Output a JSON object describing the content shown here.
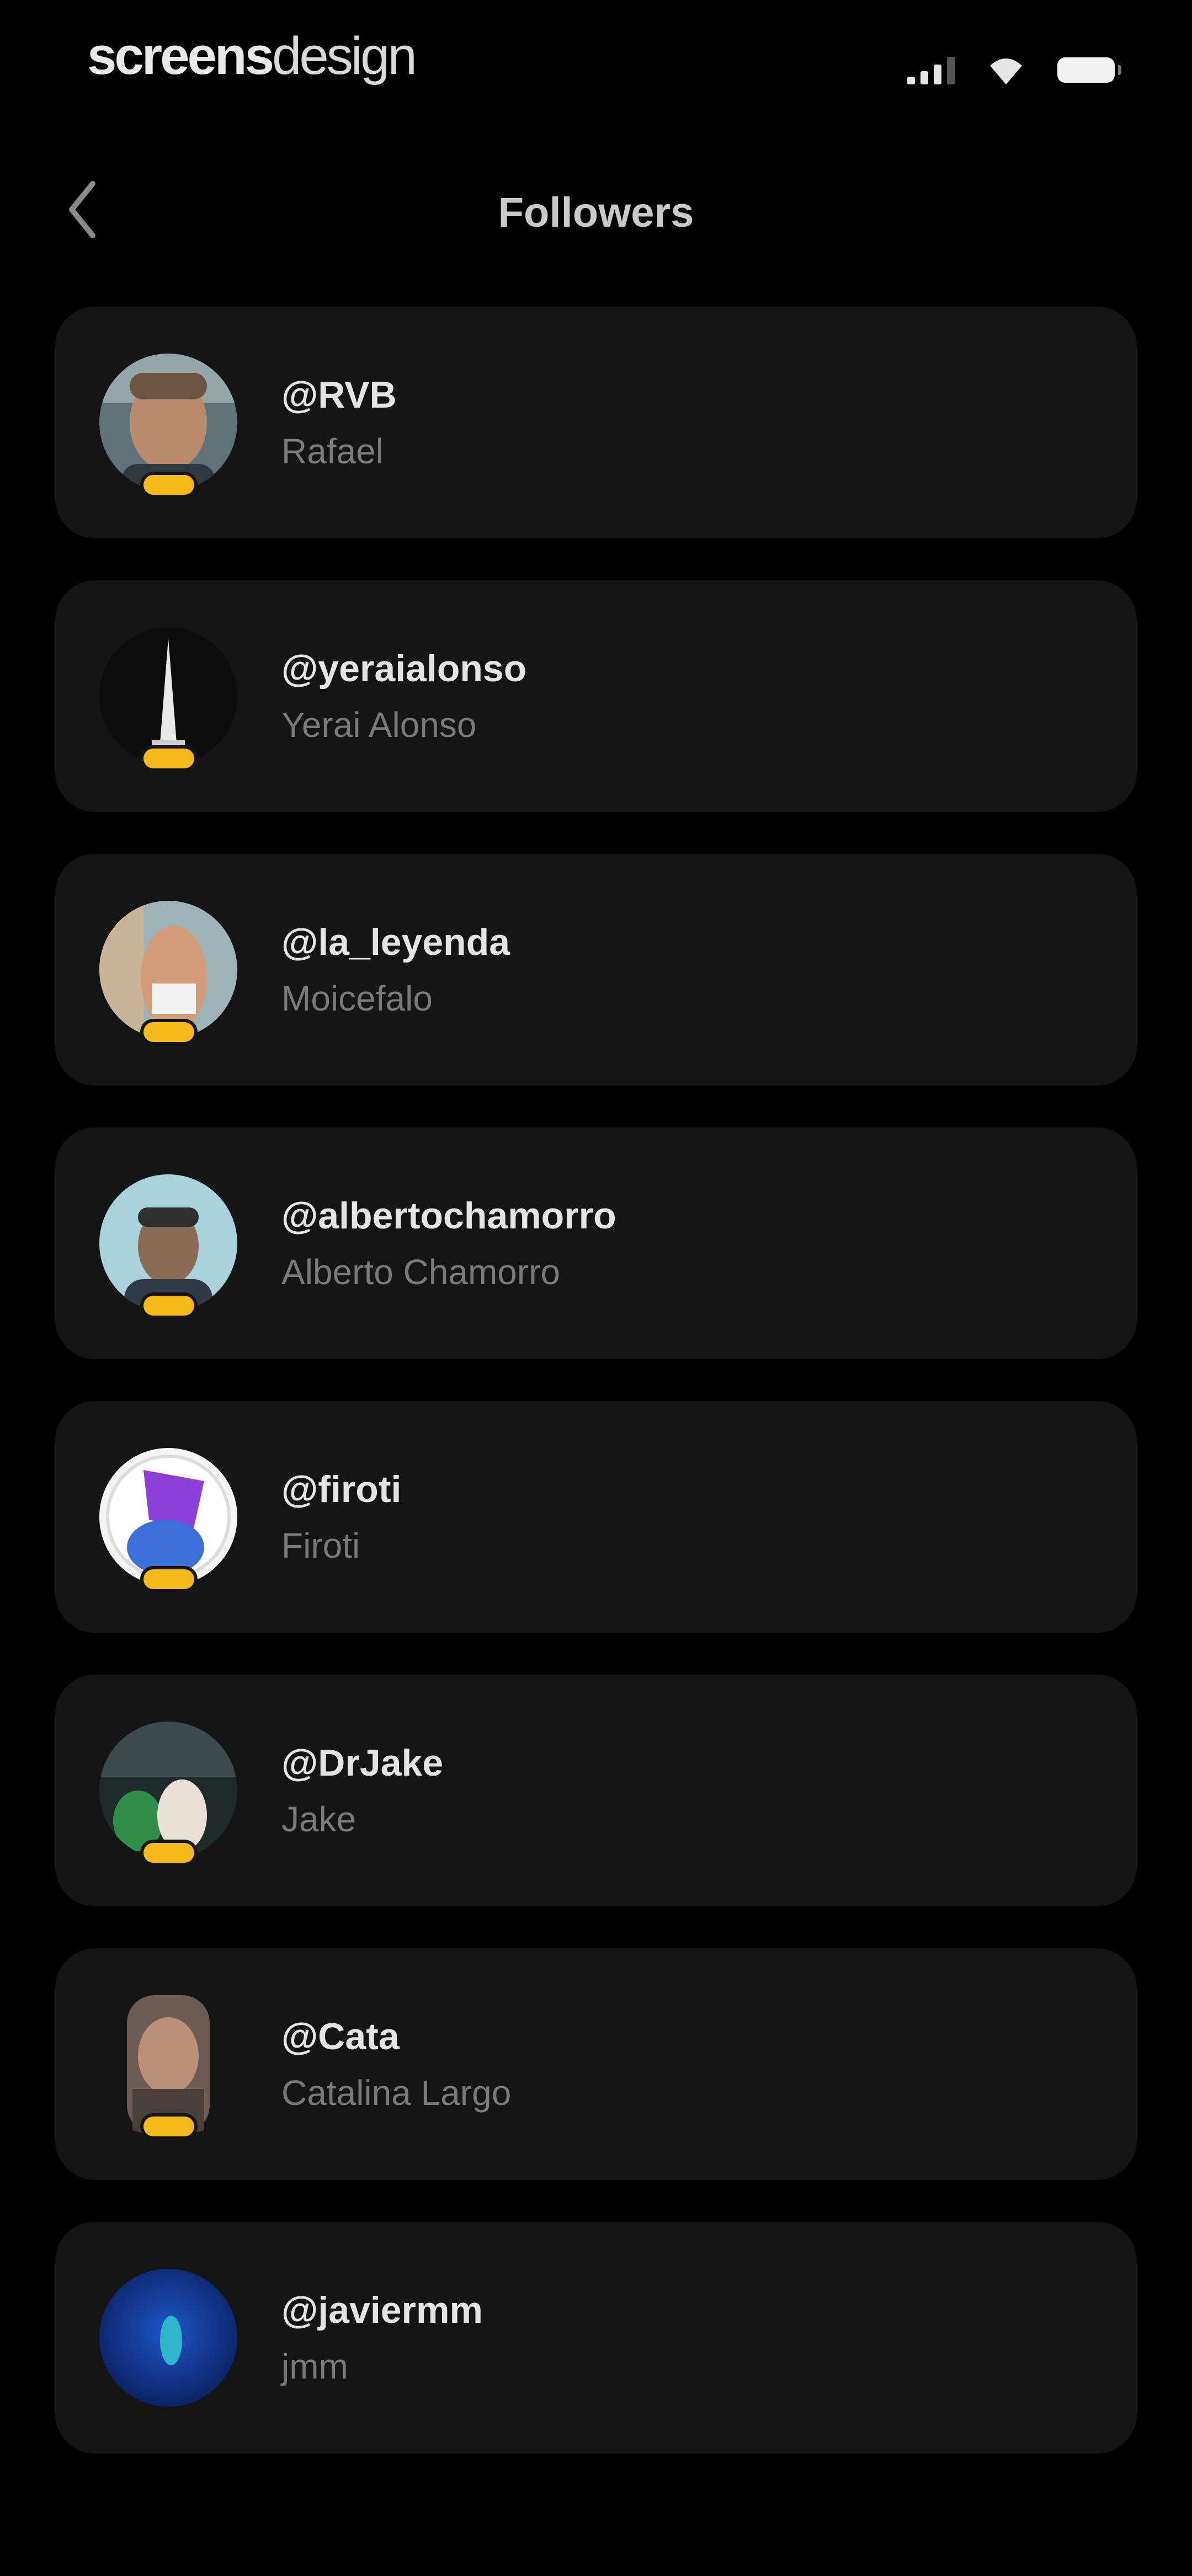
{
  "status_bar": {
    "brand_bold": "screens",
    "brand_light": "design",
    "icons": [
      "signal-icon",
      "wifi-icon",
      "battery-icon"
    ]
  },
  "header": {
    "back_icon": "chevron-left-icon",
    "title": "Followers"
  },
  "colors": {
    "background": "#000000",
    "card": "#151515",
    "badge": "#f5b91a",
    "username": "#e4e4e4",
    "display_name": "#7a7a7a"
  },
  "followers": [
    {
      "username": "@RVB",
      "name": "Rafael",
      "badge": true
    },
    {
      "username": "@yeraialonso",
      "name": "Yerai Alonso",
      "badge": true
    },
    {
      "username": "@la_leyenda",
      "name": "Moicefalo",
      "badge": true
    },
    {
      "username": "@albertochamorro",
      "name": "Alberto Chamorro",
      "badge": true
    },
    {
      "username": "@firoti",
      "name": "Firoti",
      "badge": true
    },
    {
      "username": "@DrJake",
      "name": "Jake",
      "badge": true
    },
    {
      "username": "@Cata",
      "name": "Catalina Largo",
      "badge": true
    },
    {
      "username": "@javiermm",
      "name": "jmm",
      "badge": false
    }
  ]
}
